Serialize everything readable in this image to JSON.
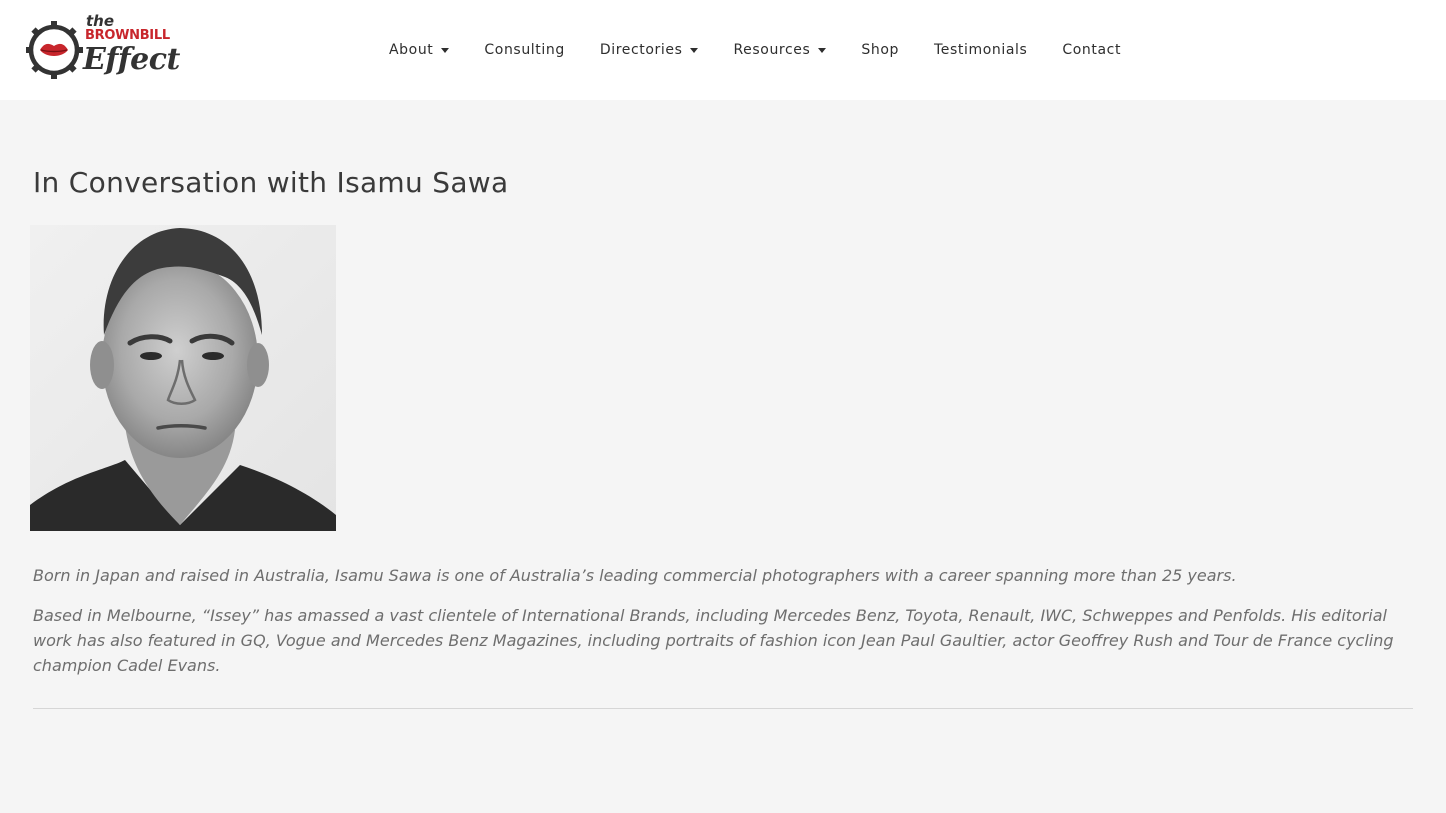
{
  "brand": {
    "logo_line1": "the",
    "logo_line2": "BROWNBILL",
    "logo_line3": "Effect",
    "accent_color": "#c8262c"
  },
  "nav": {
    "items": [
      {
        "label": "About",
        "has_dropdown": true
      },
      {
        "label": "Consulting",
        "has_dropdown": false
      },
      {
        "label": "Directories",
        "has_dropdown": true
      },
      {
        "label": "Resources",
        "has_dropdown": true
      },
      {
        "label": "Shop",
        "has_dropdown": false
      },
      {
        "label": "Testimonials",
        "has_dropdown": false
      },
      {
        "label": "Contact",
        "has_dropdown": false
      }
    ]
  },
  "article": {
    "title": "In Conversation with Isamu Sawa",
    "paragraphs": [
      "Born in Japan and raised in Australia, Isamu Sawa is one of Australia’s leading commercial photographers with a career spanning more than 25 years.",
      "Based in Melbourne, “Issey” has amassed a vast clientele of International Brands, including Mercedes Benz, Toyota, Renault, IWC, Schweppes and Penfolds. His editorial work has also featured in GQ, Vogue and Mercedes Benz Magazines, including portraits of fashion icon Jean Paul Gaultier, actor Geoffrey Rush and Tour de France cycling champion Cadel Evans."
    ]
  }
}
